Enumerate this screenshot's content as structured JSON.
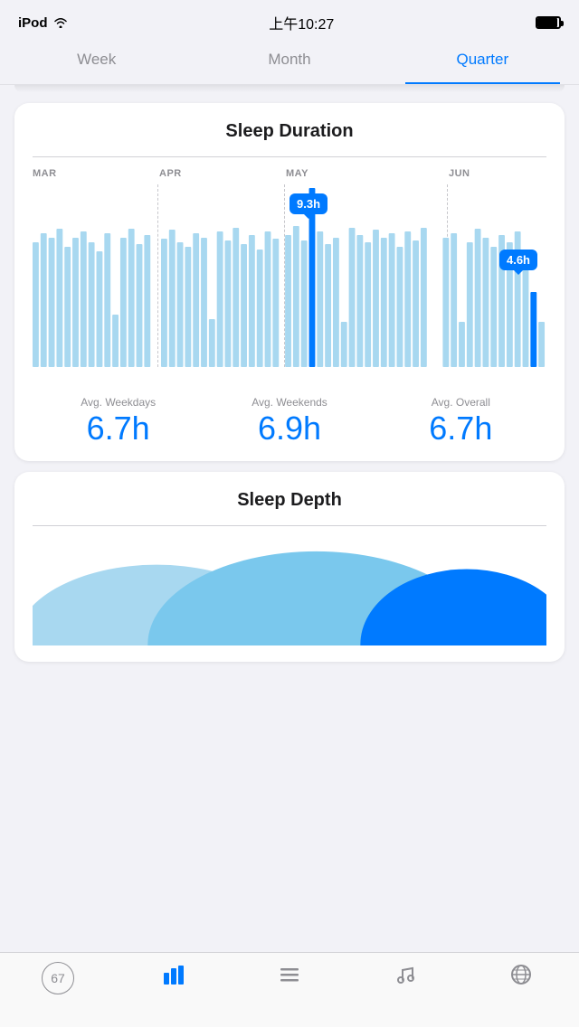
{
  "statusBar": {
    "device": "iPod",
    "time": "上午10:27",
    "battery": "full"
  },
  "tabs": {
    "items": [
      {
        "id": "week",
        "label": "Week",
        "active": false
      },
      {
        "id": "month",
        "label": "Month",
        "active": false
      },
      {
        "id": "quarter",
        "label": "Quarter",
        "active": true
      }
    ]
  },
  "sleepDuration": {
    "title": "Sleep Duration",
    "months": [
      "MAR",
      "APR",
      "MAY",
      "JUN"
    ],
    "tooltip1": {
      "value": "9.3h"
    },
    "tooltip2": {
      "value": "4.6h"
    },
    "stats": [
      {
        "label": "Avg. Weekdays",
        "value": "6.7h"
      },
      {
        "label": "Avg. Weekends",
        "value": "6.9h"
      },
      {
        "label": "Avg. Overall",
        "value": "6.7h"
      }
    ]
  },
  "sleepDepth": {
    "title": "Sleep Depth"
  },
  "bottomTabs": [
    {
      "id": "badge",
      "label": "67",
      "icon": "badge"
    },
    {
      "id": "chart",
      "label": "",
      "icon": "bar-chart",
      "active": true
    },
    {
      "id": "list",
      "label": "",
      "icon": "list"
    },
    {
      "id": "music",
      "label": "",
      "icon": "music"
    },
    {
      "id": "globe",
      "label": "",
      "icon": "globe"
    }
  ]
}
